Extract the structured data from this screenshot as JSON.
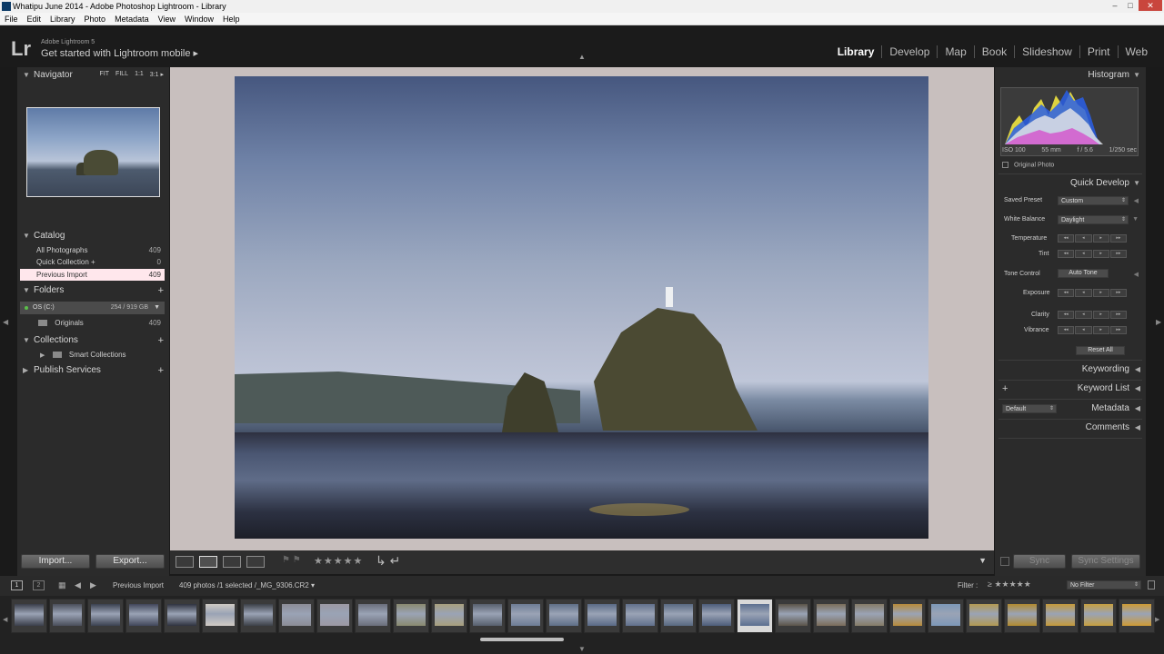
{
  "window": {
    "title": "Whatipu June 2014 - Adobe Photoshop Lightroom - Library",
    "minimize": "–",
    "maximize": "□",
    "close": "✕"
  },
  "menu": [
    "File",
    "Edit",
    "Library",
    "Photo",
    "Metadata",
    "View",
    "Window",
    "Help"
  ],
  "identity": {
    "logo": "Lr",
    "product": "Adobe Lightroom 5",
    "promo": "Get started with Lightroom mobile ▸"
  },
  "modules": [
    "Library",
    "Develop",
    "Map",
    "Book",
    "Slideshow",
    "Print",
    "Web"
  ],
  "left": {
    "navigator": {
      "title": "Navigator",
      "options": [
        "FIT",
        "FILL",
        "1:1",
        "3:1 ▸"
      ]
    },
    "catalog": {
      "title": "Catalog",
      "items": [
        {
          "label": "All Photographs",
          "count": "409"
        },
        {
          "label": "Quick Collection +",
          "count": "0"
        },
        {
          "label": "Previous Import",
          "count": "409"
        }
      ]
    },
    "folders": {
      "title": "Folders",
      "volume": "OS (C:)",
      "volume_size": "254 / 919 GB",
      "subfolder": "Originals",
      "subfolder_count": "409"
    },
    "collections": {
      "title": "Collections",
      "item": "Smart Collections"
    },
    "publish": {
      "title": "Publish Services"
    },
    "import_label": "Import...",
    "export_label": "Export..."
  },
  "toolbar": {
    "stars": "★★★★★"
  },
  "right": {
    "histogram": {
      "title": "Histogram",
      "iso": "ISO 100",
      "focal": "55 mm",
      "aperture": "f / 5.6",
      "shutter": "1/250 sec",
      "original_photo": "Original Photo"
    },
    "quick_develop": {
      "title": "Quick Develop",
      "saved_preset_label": "Saved Preset",
      "saved_preset_value": "Custom",
      "white_balance_label": "White Balance",
      "white_balance_value": "Daylight",
      "temperature_label": "Temperature",
      "tint_label": "Tint",
      "tone_control_label": "Tone Control",
      "auto_tone_label": "Auto Tone",
      "exposure_label": "Exposure",
      "clarity_label": "Clarity",
      "vibrance_label": "Vibrance",
      "reset_all_label": "Reset All"
    },
    "keywording": "Keywording",
    "keyword_list": "Keyword List",
    "metadata": {
      "title": "Metadata",
      "preset": "Default"
    },
    "comments": "Comments",
    "sync_label": "Sync",
    "sync_settings_label": "Sync Settings"
  },
  "filmbar": {
    "page1": "1",
    "page2": "2",
    "source": "Previous Import",
    "selection": "409 photos /1 selected /_MG_9306.CR2 ▾",
    "filter_label": "Filter :",
    "filter_value": "No Filter",
    "filter_stars": "≥ ★★★★★"
  }
}
